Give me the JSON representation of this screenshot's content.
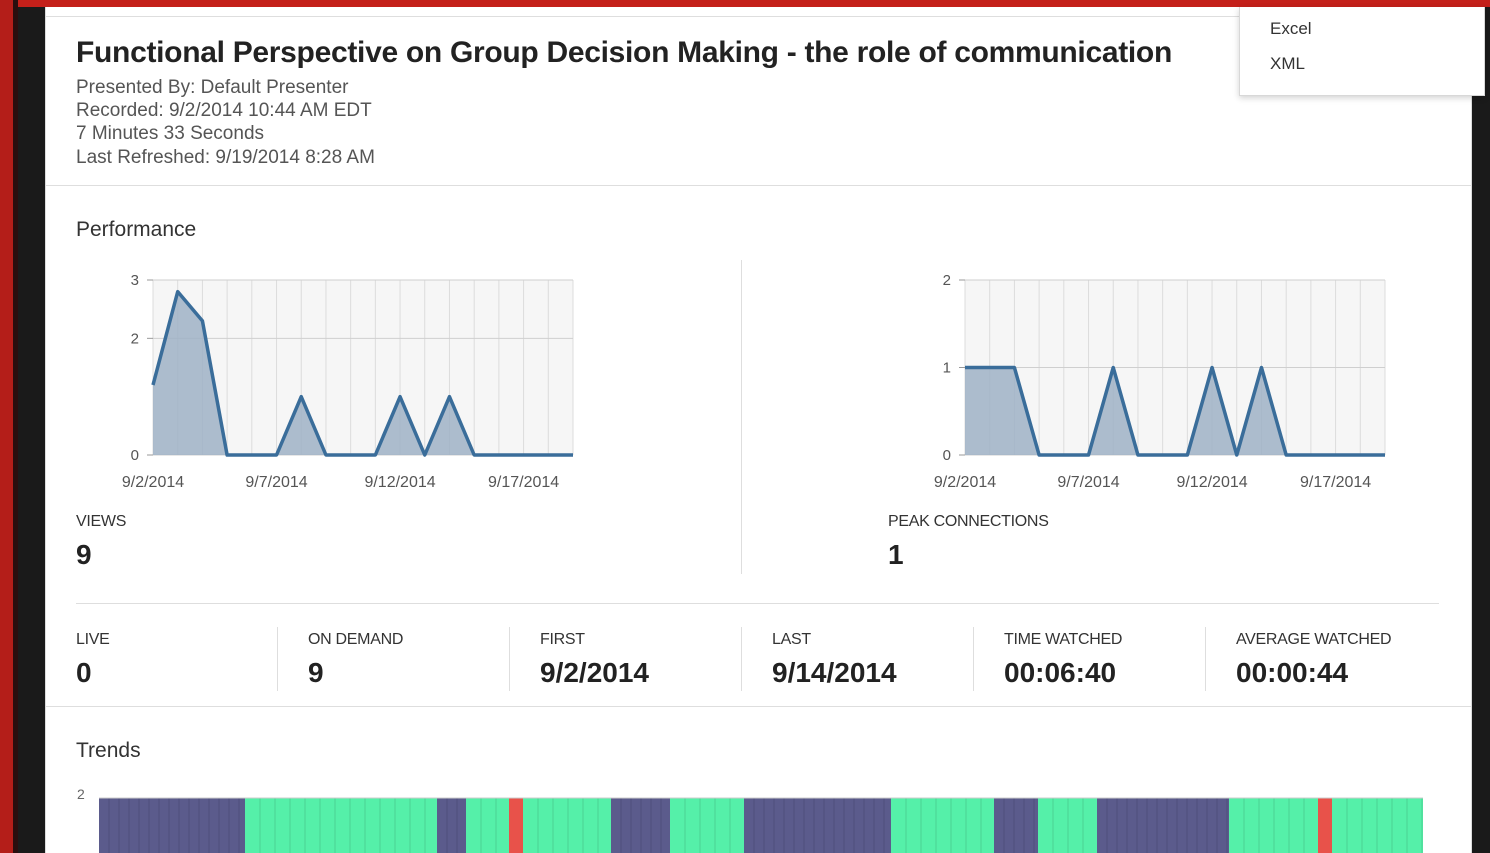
{
  "header": {
    "title": "Functional Perspective on Group Decision Making - the role of communication",
    "presented_by": "Presented By: Default Presenter",
    "recorded": "Recorded: 9/2/2014 10:44 AM EDT",
    "duration": "7 Minutes 33 Seconds",
    "last_refreshed": "Last Refreshed: 9/19/2014 8:28 AM"
  },
  "export_menu": {
    "items": [
      "Excel",
      "XML"
    ]
  },
  "performance": {
    "title": "Performance",
    "views": {
      "label": "VIEWS",
      "value": "9"
    },
    "peak": {
      "label": "PEAK CONNECTIONS",
      "value": "1"
    }
  },
  "stats": [
    {
      "label": "LIVE",
      "value": "0"
    },
    {
      "label": "ON DEMAND",
      "value": "9"
    },
    {
      "label": "FIRST",
      "value": "9/2/2014"
    },
    {
      "label": "LAST",
      "value": "9/14/2014"
    },
    {
      "label": "TIME WATCHED",
      "value": "00:06:40"
    },
    {
      "label": "AVERAGE WATCHED",
      "value": "00:00:44"
    }
  ],
  "trends": {
    "title": "Trends",
    "y_tick": "2"
  },
  "colors": {
    "line": "#3a6d9a",
    "area": "#9fb1c6",
    "trend_a": "#5b5b8c",
    "trend_b": "#55f0a9",
    "trend_red": "#e8524a"
  },
  "chart_data": [
    {
      "type": "area",
      "series_key": "views",
      "x": [
        "9/2/2014",
        "9/3/2014",
        "9/4/2014",
        "9/5/2014",
        "9/6/2014",
        "9/7/2014",
        "9/8/2014",
        "9/9/2014",
        "9/10/2014",
        "9/11/2014",
        "9/12/2014",
        "9/13/2014",
        "9/14/2014",
        "9/15/2014",
        "9/16/2014",
        "9/17/2014",
        "9/18/2014",
        "9/19/2014"
      ],
      "values": [
        1.2,
        2.8,
        2.3,
        0,
        0,
        0,
        1,
        0,
        0,
        0,
        1,
        0,
        1,
        0,
        0,
        0,
        0,
        0
      ],
      "ylim": [
        0,
        3
      ],
      "yticks": [
        "0",
        "2",
        "3"
      ],
      "xticks": [
        "9/2/2014",
        "9/7/2014",
        "9/12/2014",
        "9/17/2014"
      ]
    },
    {
      "type": "area",
      "series_key": "peak_connections",
      "x": [
        "9/2/2014",
        "9/3/2014",
        "9/4/2014",
        "9/5/2014",
        "9/6/2014",
        "9/7/2014",
        "9/8/2014",
        "9/9/2014",
        "9/10/2014",
        "9/11/2014",
        "9/12/2014",
        "9/13/2014",
        "9/14/2014",
        "9/15/2014",
        "9/16/2014",
        "9/17/2014",
        "9/18/2014",
        "9/19/2014"
      ],
      "values": [
        1,
        1,
        1,
        0,
        0,
        0,
        1,
        0,
        0,
        0,
        1,
        0,
        1,
        0,
        0,
        0,
        0,
        0
      ],
      "ylim": [
        0,
        2
      ],
      "yticks": [
        "0",
        "1",
        "2"
      ],
      "xticks": [
        "9/2/2014",
        "9/7/2014",
        "9/12/2014",
        "9/17/2014"
      ]
    },
    {
      "type": "bar",
      "series_key": "trends",
      "segments": [
        "a",
        "b",
        "a",
        "b",
        "r",
        "b",
        "a",
        "b",
        "a",
        "b",
        "a",
        "b",
        "a",
        "b",
        "r",
        "b"
      ]
    }
  ]
}
